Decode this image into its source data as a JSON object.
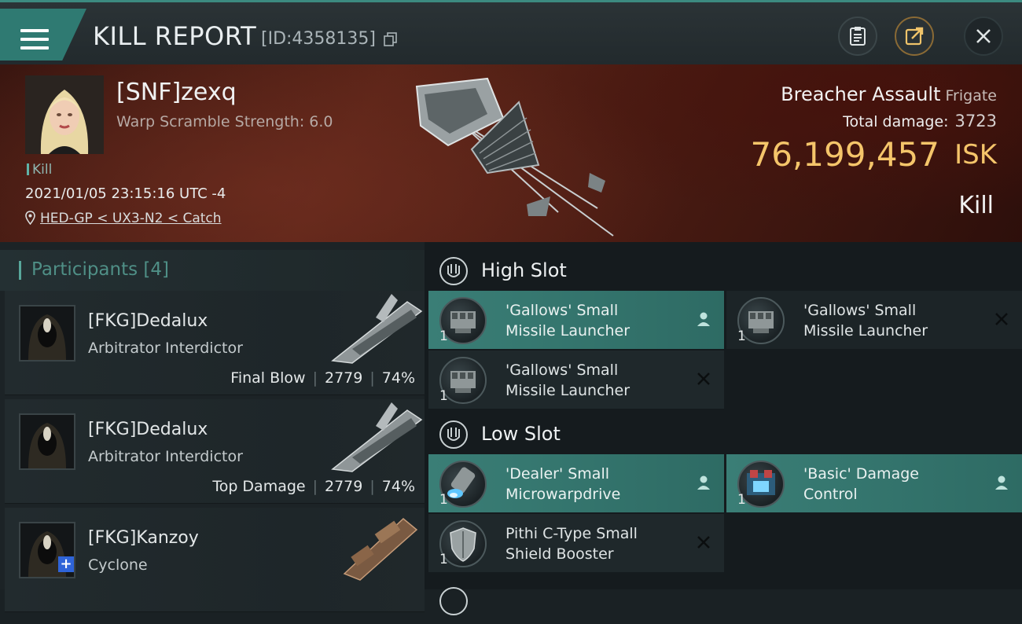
{
  "header": {
    "title": "KILL REPORT",
    "report_id": "[ID:4358135]"
  },
  "victim": {
    "pilot_name": "[SNF]zexq",
    "warp_scramble": "Warp Scramble Strength: 6.0",
    "tag": "Kill",
    "timestamp": "2021/01/05 23:15:16 UTC -4",
    "location": "HED-GP < UX3-N2 < Catch",
    "ship_name": "Breacher Assault",
    "ship_class": "Frigate",
    "total_damage_label": "Total damage:",
    "total_damage": "3723",
    "isk_value": "76,199,457",
    "isk_unit": "ISK",
    "result": "Kill"
  },
  "participants": {
    "title": "Participants",
    "count": "[4]",
    "items": [
      {
        "name": "[FKG]Dedalux",
        "ship": "Arbitrator Interdictor",
        "role": "Final Blow",
        "damage": "2779",
        "percent": "74%"
      },
      {
        "name": "[FKG]Dedalux",
        "ship": "Arbitrator Interdictor",
        "role": "Top Damage",
        "damage": "2779",
        "percent": "74%"
      },
      {
        "name": "[FKG]Kanzoy",
        "ship": "Cyclone"
      }
    ]
  },
  "slots": {
    "high": {
      "title": "High Slot",
      "modules": [
        {
          "line1": "'Gallows' Small",
          "line2": "Missile Launcher",
          "qty": "1",
          "status": "fitted"
        },
        {
          "line1": "'Gallows' Small",
          "line2": "Missile Launcher",
          "qty": "1",
          "status": "destroyed"
        },
        {
          "line1": "'Gallows' Small",
          "line2": "Missile Launcher",
          "qty": "1",
          "status": "destroyed"
        }
      ]
    },
    "low": {
      "title": "Low Slot",
      "modules": [
        {
          "line1": "'Dealer' Small",
          "line2": "Microwarpdrive",
          "qty": "1",
          "status": "fitted"
        },
        {
          "line1": "'Basic' Damage",
          "line2": "Control",
          "qty": "1",
          "status": "fitted"
        },
        {
          "line1": "Pithi C-Type Small",
          "line2": "Shield Booster",
          "qty": "1",
          "status": "destroyed"
        }
      ]
    }
  },
  "colors": {
    "accent_teal": "#3a7e76",
    "isk_gold": "#f5c56a",
    "banner_red": "#5b2418"
  },
  "icons": [
    "menu-icon",
    "copy-icon",
    "clipboard-icon",
    "share-icon",
    "close-icon",
    "location-pin-icon",
    "slot-icon",
    "person-icon",
    "x-icon"
  ]
}
